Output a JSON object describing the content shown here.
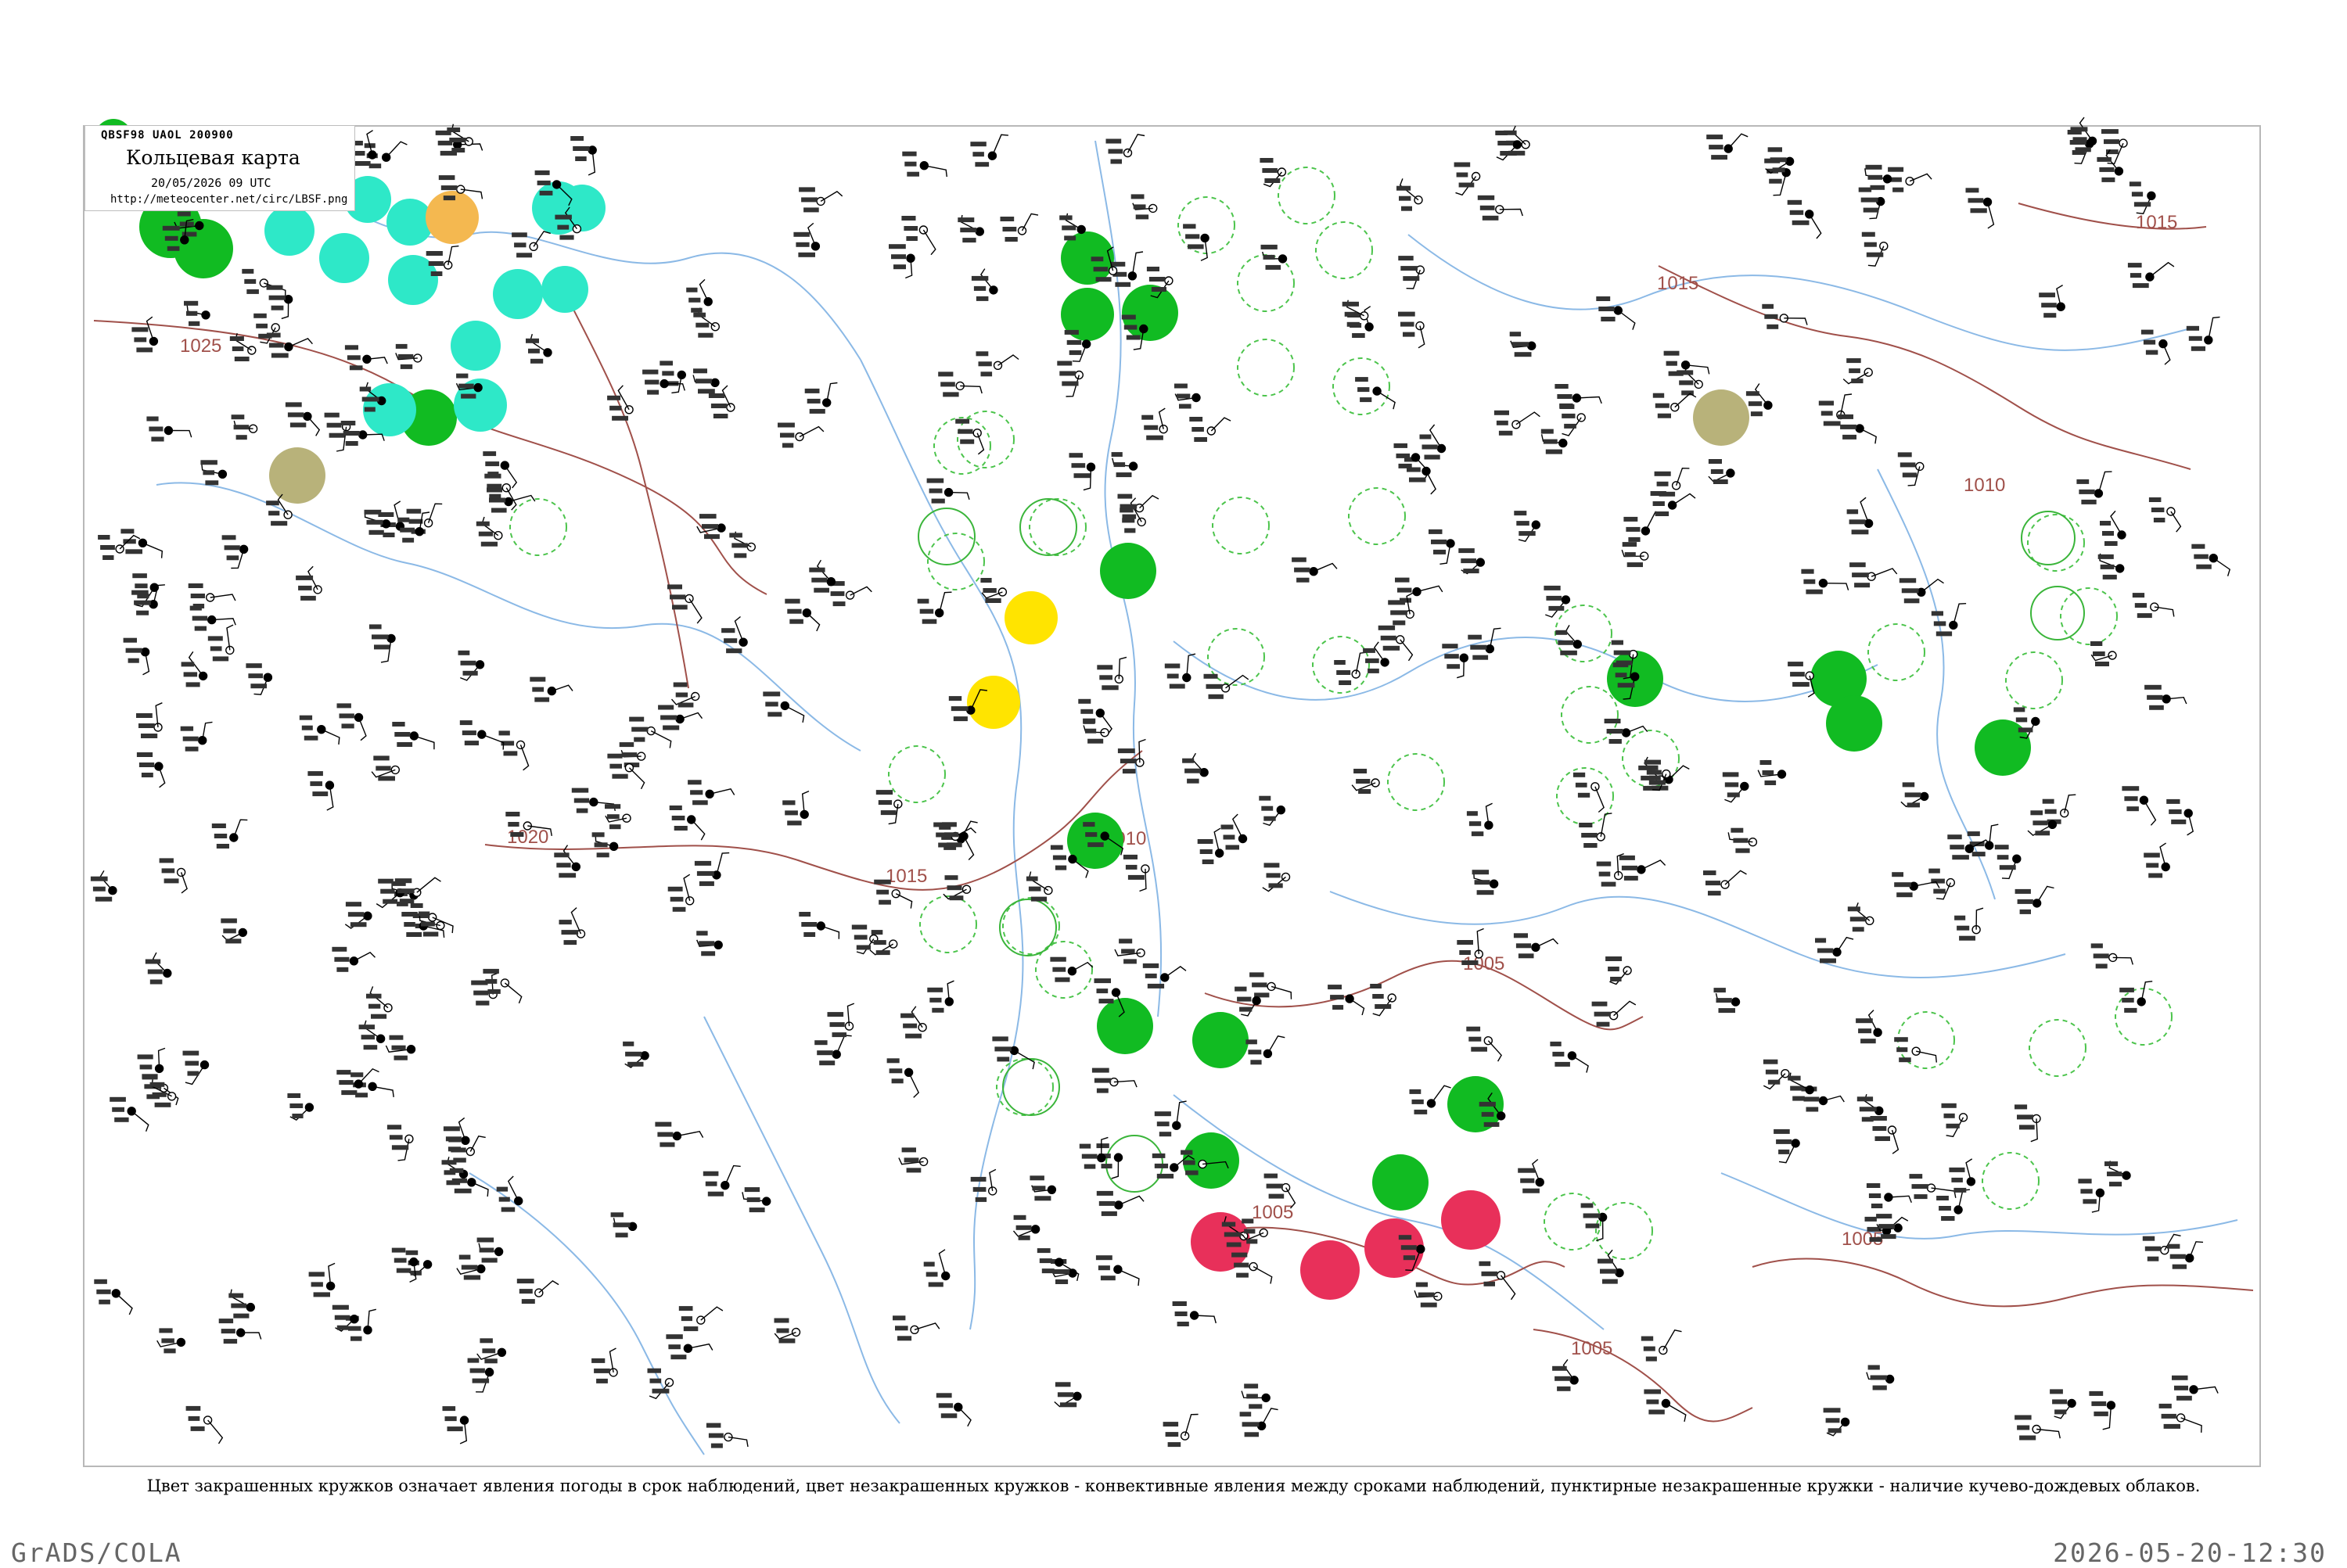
{
  "legend": {
    "code": "QBSF98  UAOL  200900",
    "title": "Кольцевая карта",
    "date": "20/05/2026 09 UTC",
    "url": "http://meteocenter.net/circ/LBSF.png"
  },
  "caption": "Цвет закрашенных кружков означает явления погоды в срок наблюдений, цвет незакрашенных кружков - конвективные явления между сроками наблюдений, пунктирные незакрашенные кружки - наличие кучево-дождевых облаков.",
  "footer": {
    "left": "GrADS/COLA",
    "right": "2026-05-20-12:30"
  },
  "isobar_labels": [
    "1025",
    "1020",
    "1015",
    "1010",
    "1005",
    "1005",
    "1005",
    "1005",
    "1015",
    "1010",
    "1015"
  ],
  "colors": {
    "rain": "#11bb22",
    "shower": "#2ee8c8",
    "thunder": "#e8305a",
    "fog": "#ffe400",
    "haze": "#b8b27a",
    "snow": "#f4b850",
    "river": "#8bb9e6",
    "isobar": "#a0504a"
  },
  "icons": [
    "station-dot-icon",
    "wind-barb-icon"
  ]
}
